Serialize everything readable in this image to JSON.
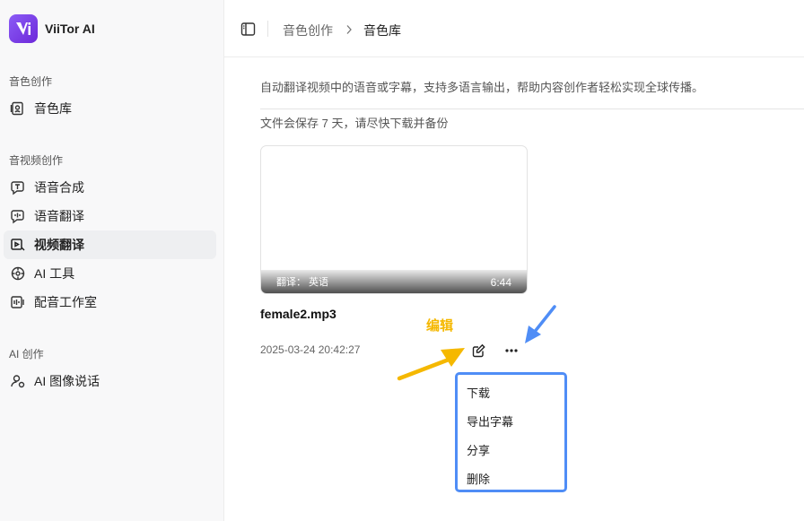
{
  "app": {
    "name": "ViiTor AI"
  },
  "sidebar": {
    "sections": [
      {
        "title": "音色创作",
        "items": [
          {
            "label": "音色库",
            "icon": "voice-library-icon"
          }
        ]
      },
      {
        "title": "音视频创作",
        "items": [
          {
            "label": "语音合成",
            "icon": "speech-synthesis-icon"
          },
          {
            "label": "语音翻译",
            "icon": "speech-translation-icon"
          },
          {
            "label": "视频翻译",
            "icon": "video-translation-icon",
            "active": true
          },
          {
            "label": "AI 工具",
            "icon": "ai-tools-icon"
          },
          {
            "label": "配音工作室",
            "icon": "dubbing-studio-icon"
          }
        ]
      },
      {
        "title": "AI 创作",
        "items": [
          {
            "label": "AI 图像说话",
            "icon": "talking-image-icon"
          }
        ]
      }
    ]
  },
  "header": {
    "breadcrumb": [
      "音色创作",
      "音色库"
    ]
  },
  "main": {
    "description": "自动翻译视频中的语音或字幕，支持多语言输出，帮助内容创作者轻松实现全球传播。",
    "notice": "文件会保存 7 天，请尽快下载并备份",
    "card": {
      "translate_label": "翻译：  英语",
      "duration": "6:44",
      "filename": "female2.mp3",
      "date": "2025-03-24 20:42:27"
    }
  },
  "annotation": {
    "label": "编辑",
    "colors": {
      "yellow": "#f5b800",
      "blue": "#4f8df6"
    }
  },
  "menu": {
    "items": [
      "下载",
      "导出字幕",
      "分享",
      "删除"
    ]
  },
  "colors": {
    "brand": "#7c3aed",
    "active_bg": "#eeeff1"
  }
}
